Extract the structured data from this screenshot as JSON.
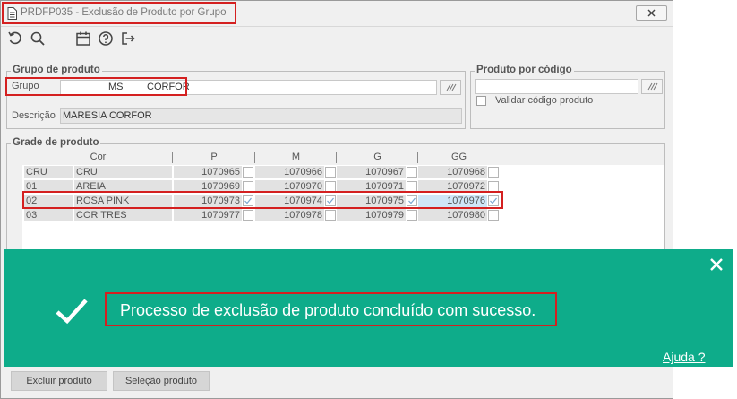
{
  "window": {
    "title": "PRDFP035 - Exclusão de Produto por Grupo",
    "close_icon": "close-icon"
  },
  "toolbar": {
    "icons": [
      "undo-icon",
      "search-icon",
      "calendar-icon",
      "help-icon",
      "exit-icon"
    ]
  },
  "grupo_produto": {
    "legend": "Grupo de produto",
    "grupo_label": "Grupo",
    "grupo_code": "MS",
    "grupo_name": "CORFOR",
    "descricao_label": "Descrição",
    "descricao_value": "MARESIA CORFOR"
  },
  "produto_codigo": {
    "legend": "Produto por código",
    "validar_label": "Validar código produto",
    "validar_checked": false
  },
  "grade": {
    "legend": "Grade de produto",
    "columns": [
      "Cor",
      "P",
      "M",
      "G",
      "GG"
    ],
    "rows": [
      {
        "code": "CRU",
        "name": "CRU",
        "values": [
          "1070965",
          "1070966",
          "1070967",
          "1070968"
        ],
        "checks": [
          false,
          false,
          false,
          false
        ]
      },
      {
        "code": "01",
        "name": "AREIA",
        "values": [
          "1070969",
          "1070970",
          "1070971",
          "1070972"
        ],
        "checks": [
          false,
          false,
          false,
          false
        ]
      },
      {
        "code": "02",
        "name": "ROSA PINK",
        "values": [
          "1070973",
          "1070974",
          "1070975",
          "1070976"
        ],
        "checks": [
          true,
          true,
          true,
          true
        ]
      },
      {
        "code": "03",
        "name": "COR TRES",
        "values": [
          "1070977",
          "1070978",
          "1070979",
          "1070980"
        ],
        "checks": [
          false,
          false,
          false,
          false
        ]
      }
    ]
  },
  "buttons": {
    "excluir": "Excluir produto",
    "selecao": "Seleção produto"
  },
  "toast": {
    "message": "Processo de exclusão de produto concluído com sucesso.",
    "help": "Ajuda ?",
    "color": "#0eac8a"
  },
  "colors": {
    "highlight": "#d42020",
    "selected_cell": "#cfe6f7"
  }
}
